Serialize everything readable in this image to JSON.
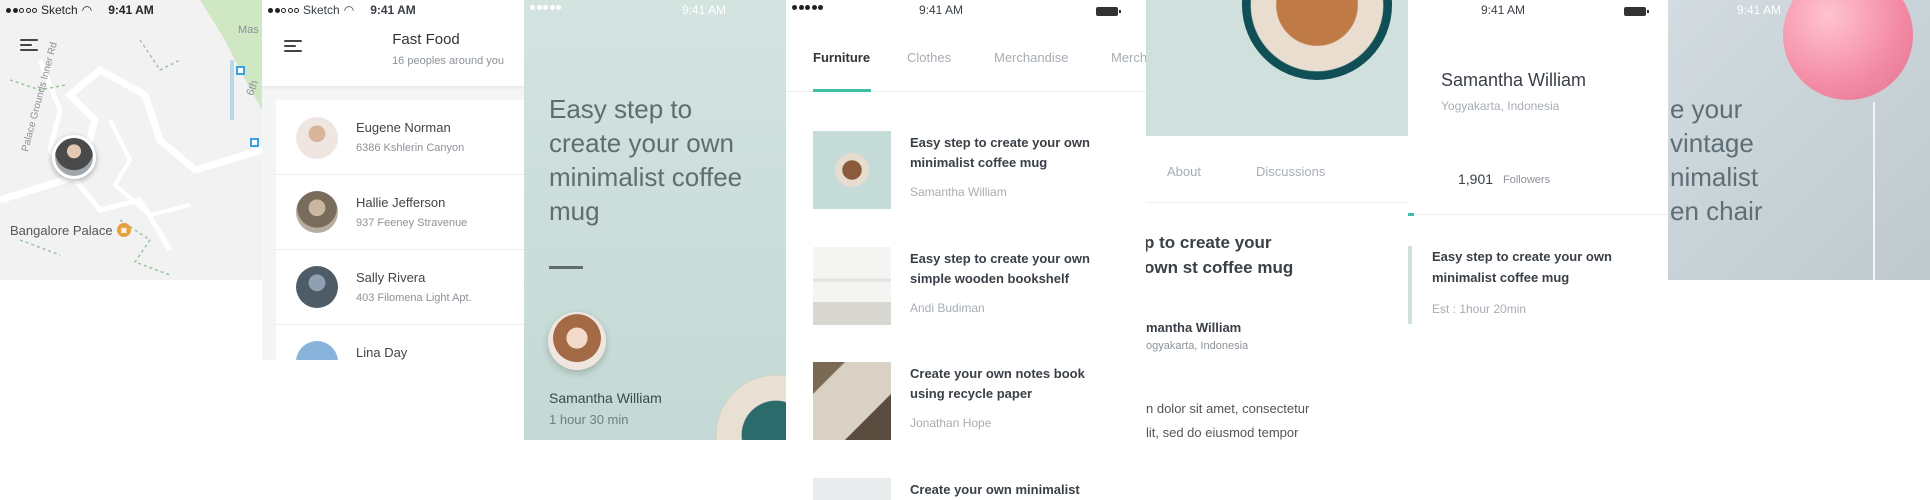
{
  "status": {
    "carrier": "Sketch",
    "time": "9:41 AM"
  },
  "colors": {
    "accent": "#3dbfa3",
    "mint": "#c9dcda",
    "map_bg": "#f2f2f2"
  },
  "map": {
    "road_label": "Palace Grounds Inner Rd",
    "place_label": "Bangalore Palace",
    "edge_label_1": "Mas",
    "edge_label_2": "6th",
    "pin_icon": "palace-pin-icon"
  },
  "fastfood": {
    "title": "Fast Food",
    "subtitle": "16 peoples around you",
    "people": [
      {
        "name": "Eugene Norman",
        "address": "6386 Kshlerin Canyon"
      },
      {
        "name": "Hallie Jefferson",
        "address": "937 Feeney Stravenue"
      },
      {
        "name": "Sally Rivera",
        "address": "403 Filomena Light Apt."
      },
      {
        "name": "Lina Day",
        "address": ""
      }
    ]
  },
  "article": {
    "title": "Easy step to create your own minimalist coffee mug",
    "author": "Samantha William",
    "duration": "1 hour 30 min"
  },
  "shop": {
    "tabs": [
      "Furniture",
      "Clothes",
      "Merchandise",
      "Merch"
    ],
    "active_tab": "Furniture",
    "items": [
      {
        "title": "Easy step to create your own minimalist coffee mug",
        "author": "Samantha William"
      },
      {
        "title": "Easy step to create your own simple wooden bookshelf",
        "author": "Andi Budiman"
      },
      {
        "title": "Create your own notes book using recycle paper",
        "author": "Jonathan Hope"
      },
      {
        "title": "Create your own minimalist",
        "author": ""
      }
    ]
  },
  "detail": {
    "tabs": [
      "About",
      "Discussions"
    ],
    "title": "p to create your own st coffee mug",
    "author": "mantha William",
    "location": "ogyakarta, Indonesia",
    "body_line1": "n dolor sit amet, consectetur",
    "body_line2": "lit, sed do eiusmod tempor"
  },
  "profile": {
    "name": "Samantha William",
    "location": "Yogyakarta, Indonesia",
    "followers_count": "1,901",
    "followers_label": "Followers",
    "card_title": "Easy step to create your own minimalist coffee mug",
    "card_meta": "Est : 1hour 20min"
  },
  "balloon": {
    "title_lines": [
      "e your",
      "vintage",
      "nimalist",
      "en chair"
    ]
  }
}
